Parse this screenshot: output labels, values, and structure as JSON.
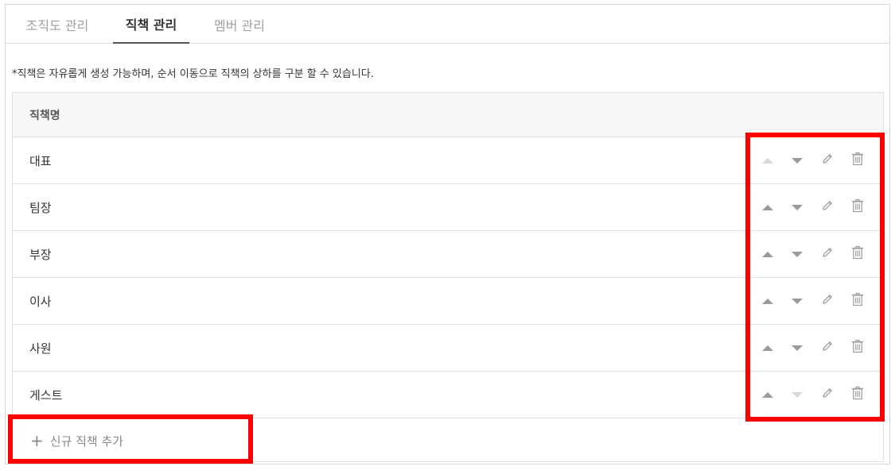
{
  "tabs": [
    {
      "label": "조직도 관리",
      "active": false
    },
    {
      "label": "직책 관리",
      "active": true
    },
    {
      "label": "멤버 관리",
      "active": false
    }
  ],
  "notice": "*직책은 자유롭게 생성 가능하며, 순서 이동으로 직책의 상하를 구분 할 수 있습니다.",
  "table": {
    "header": "직책명",
    "rows": [
      {
        "name": "대표",
        "up_enabled": false,
        "down_enabled": true
      },
      {
        "name": "팀장",
        "up_enabled": true,
        "down_enabled": true
      },
      {
        "name": "부장",
        "up_enabled": true,
        "down_enabled": true
      },
      {
        "name": "이사",
        "up_enabled": true,
        "down_enabled": true
      },
      {
        "name": "사원",
        "up_enabled": true,
        "down_enabled": true
      },
      {
        "name": "게스트",
        "up_enabled": true,
        "down_enabled": false
      }
    ],
    "row_actions": [
      "move-up-icon",
      "move-down-icon",
      "pencil-icon",
      "trash-icon"
    ]
  },
  "add_button": {
    "icon": "+",
    "label": "신규 직책 추가"
  },
  "colors": {
    "highlight": "#ff0000",
    "icon": "#9a9a9a",
    "icon_disabled": "#d8d8d8"
  }
}
